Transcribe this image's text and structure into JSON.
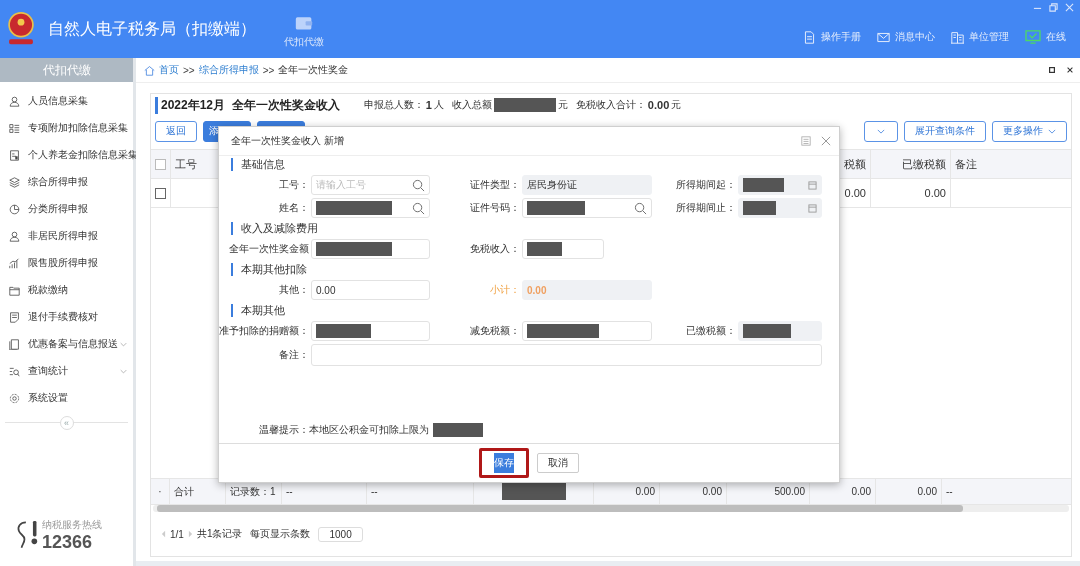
{
  "app": {
    "title": "自然人电子税务局（扣缴端）"
  },
  "nav": [
    {
      "label": "代扣代缴"
    }
  ],
  "header_links": [
    {
      "label": "操作手册",
      "kind": "manual"
    },
    {
      "label": "消息中心",
      "kind": "mail"
    },
    {
      "label": "单位管理",
      "kind": "building"
    },
    {
      "label": "在线",
      "kind": "online"
    }
  ],
  "sidebar": {
    "title": "代扣代缴",
    "items": [
      {
        "label": "人员信息采集",
        "kind": "person",
        "submenu": false
      },
      {
        "label": "专项附加扣除信息采集",
        "kind": "list",
        "submenu": false
      },
      {
        "label": "个人养老金扣除信息采集",
        "kind": "card",
        "submenu": false
      },
      {
        "label": "综合所得申报",
        "kind": "layers",
        "submenu": false
      },
      {
        "label": "分类所得申报",
        "kind": "pie",
        "submenu": false
      },
      {
        "label": "非居民所得申报",
        "kind": "person",
        "submenu": false
      },
      {
        "label": "限售股所得申报",
        "kind": "bars",
        "submenu": false
      },
      {
        "label": "税款缴纳",
        "kind": "folder",
        "submenu": false
      },
      {
        "label": "退付手续费核对",
        "kind": "doc",
        "submenu": false
      },
      {
        "label": "优惠备案与信息报送",
        "kind": "page",
        "submenu": true
      },
      {
        "label": "查询统计",
        "kind": "search",
        "submenu": true
      },
      {
        "label": "系统设置",
        "kind": "gear",
        "submenu": false
      }
    ],
    "collapse": "«",
    "hotline_label": "纳税服务热线",
    "hotline_number": "12366"
  },
  "breadcrumb": {
    "separator": ">>",
    "items": [
      {
        "label": "首页",
        "link": true
      },
      {
        "label": "综合所得申报",
        "link": true
      },
      {
        "label": "全年一次性奖金",
        "link": false
      }
    ]
  },
  "summary": {
    "period": "2022年12月",
    "title": "全年一次性奖金收入",
    "people_label": "申报总人数：",
    "people": "1",
    "people_unit": "人",
    "income_label": "收入总额",
    "income_redacted": true,
    "income_unit": "元",
    "exempt_label": "免税收入合计：",
    "exempt": "0.00",
    "exempt_unit": "元"
  },
  "toolbar": {
    "left": [
      {
        "label": "返回",
        "kind": "outline"
      },
      {
        "label": "添",
        "kind": "primary"
      },
      {
        "kind": "primary"
      }
    ],
    "right": [
      {
        "kind": "dropdown"
      },
      {
        "label": "展开查询条件",
        "kind": "outline"
      },
      {
        "label": "更多操作",
        "kind": "dropdown"
      }
    ]
  },
  "table": {
    "select_all": false,
    "columns": [
      {
        "label": "工号"
      },
      {
        "label": "税额"
      },
      {
        "label": "已缴税额"
      },
      {
        "label": "备注"
      }
    ],
    "rows": [
      {
        "selected": false,
        "cells": [
          "",
          "0.00",
          "0.00"
        ]
      }
    ],
    "totals": {
      "marker": "·",
      "label": "合计",
      "count": "记录数：1",
      "cells": [
        {
          "text": "--"
        },
        {
          "text": "--"
        },
        {
          "redacted": true
        },
        {
          "text": "0.00"
        },
        {
          "text": "0.00"
        },
        {
          "text": "500.00"
        },
        {
          "text": "0.00"
        },
        {
          "text": "0.00"
        },
        {
          "text": "--"
        }
      ]
    }
  },
  "pagination": {
    "page": "1/1",
    "total": "共1条记录",
    "per_page_label": "每页显示条数",
    "per_page": "1000"
  },
  "modal": {
    "title": "全年一次性奖金收入 新增",
    "sections": [
      {
        "title": "基础信息",
        "fields": [
          {
            "label": "工号：",
            "placeholder": "请输入工号",
            "kind": "search",
            "redacted": false
          },
          {
            "label": "证件类型：",
            "value": "居民身份证",
            "kind": "readonly",
            "redacted": false
          },
          {
            "label": "所得期间起：",
            "kind": "date",
            "redacted": true
          },
          {
            "label": "姓名：",
            "kind": "search",
            "redacted": true
          },
          {
            "label": "证件号码：",
            "kind": "search",
            "redacted": true
          },
          {
            "label": "所得期间止：",
            "kind": "date",
            "redacted": true
          }
        ]
      },
      {
        "title": "收入及减除费用",
        "fields": [
          {
            "label": "全年一次性奖金额",
            "kind": "text",
            "redacted": true
          },
          {
            "label": "免税收入：",
            "kind": "short",
            "redacted": true
          }
        ]
      },
      {
        "title": "本期其他扣除",
        "fields": [
          {
            "label": "其他：",
            "value": "0.00",
            "kind": "text",
            "redacted": false
          },
          {
            "label": "小计：",
            "value": "0.00",
            "kind": "subtotal",
            "redacted": false
          }
        ]
      },
      {
        "title": "本期其他",
        "fields": [
          {
            "label": "准予扣除的捐赠额：",
            "kind": "text",
            "redacted": true
          },
          {
            "label": "减免税额：",
            "kind": "text",
            "redacted": true
          },
          {
            "label": "已缴税额：",
            "kind": "readonly",
            "redacted": true
          },
          {
            "label": "备注：",
            "kind": "wide",
            "redacted": false
          }
        ]
      }
    ],
    "tip": "温馨提示：本地区公积金可扣除上限为",
    "tip_redacted": true,
    "buttons": [
      {
        "label": "保存",
        "kind": "primary",
        "highlighted": true
      },
      {
        "label": "取消",
        "kind": "default",
        "highlighted": false
      }
    ]
  }
}
